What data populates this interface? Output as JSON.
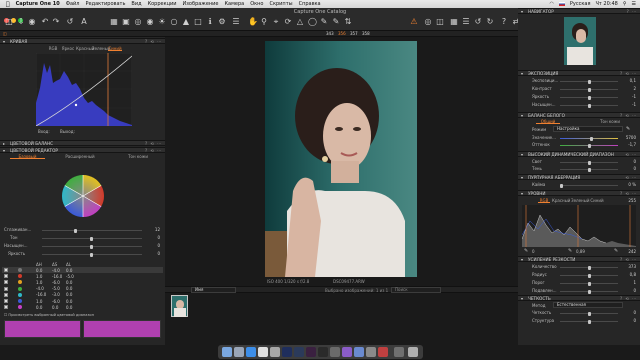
{
  "menubar": {
    "app_name": "Capture One 10",
    "items": [
      "Файл",
      "Редактировать",
      "Вид",
      "Коррекции",
      "Изображение",
      "Камера",
      "Окно",
      "Скрипты",
      "Справка"
    ],
    "input_source": "Русская",
    "clock": "Чт 20:48"
  },
  "window": {
    "title": "Capture One Catalog"
  },
  "exposure_readout": {
    "a": "343",
    "b": "356",
    "c": "357",
    "d": "358"
  },
  "left": {
    "curves": {
      "title": "КРИВАЯ",
      "tabs": [
        "RGB",
        "Яркос",
        "Красный",
        "Зеленый",
        "Синий"
      ],
      "active_tab": 4,
      "input_label": "Вход:",
      "output_label": "Выход:"
    },
    "color_balance": {
      "title": "ЦВЕТОВОЙ БАЛАНС"
    },
    "color_editor": {
      "title": "ЦВЕТОВОЙ РЕДАКТОР",
      "tabs": [
        "Базовый",
        "Расширенный",
        "Тон кожи"
      ],
      "active_tab": 0,
      "sliders": [
        {
          "label": "Сглаживан...",
          "value": "12"
        },
        {
          "label": "Тон",
          "value": "0"
        },
        {
          "label": "Насыщен...",
          "value": "0"
        },
        {
          "label": "Яркость",
          "value": "0"
        }
      ],
      "table_headers": [
        "ΔH",
        "ΔS",
        "ΔL"
      ],
      "rows": [
        {
          "color": "#777777",
          "h": "0.0",
          "s": "-4.0",
          "l": "0.0"
        },
        {
          "color": "#d23a2a",
          "h": "1.0",
          "s": "-16.0",
          "l": "-5.0"
        },
        {
          "color": "#e2a020",
          "h": "1.0",
          "s": "-6.0",
          "l": "0.0"
        },
        {
          "color": "#3fae3f",
          "h": "-4.0",
          "s": "-5.0",
          "l": "0.0"
        },
        {
          "color": "#2fb8c8",
          "h": "-16.0",
          "s": "-3.0",
          "l": "0.0"
        },
        {
          "color": "#3a5ad8",
          "h": "1.0",
          "s": "-6.0",
          "l": "0.0"
        },
        {
          "color": "#c840c8",
          "h": "0.0",
          "s": "0.0",
          "l": "0.0"
        }
      ],
      "view_selected": "Просмотреть выбранный цветовой диапазон",
      "swatch_color": "#b040b0"
    }
  },
  "viewer": {
    "caption": "ISO 400   1/320 s   f/2.8",
    "filename": "DSC09477.ARW",
    "filmstrip_label": "Имя",
    "filmstrip_count": "Выбрано изображений: 1 из 1",
    "search_placeholder": "Поиск"
  },
  "right": {
    "navigator": {
      "title": "НАВИГАТОР"
    },
    "exposure": {
      "title": "ЭКСПОЗИЦИЯ",
      "sliders": [
        {
          "label": "Экспозици...",
          "value": "0,1"
        },
        {
          "label": "Контраст",
          "value": "2"
        },
        {
          "label": "Яркость",
          "value": "-1"
        },
        {
          "label": "Насыщен...",
          "value": "-1"
        }
      ]
    },
    "white_balance": {
      "title": "БАЛАНС БЕЛОГО",
      "tabs": [
        "Общий",
        "Тон кожи"
      ],
      "active_tab": 0,
      "mode_label": "Режим",
      "mode_value": "Настройка",
      "kelvin_label": "Значение...",
      "kelvin_value": "5700",
      "tint_label": "Оттенок",
      "tint_value": "-1,7"
    },
    "hdr": {
      "title": "ВЫСОКИЙ ДИНАМИЧЕСКИЙ ДИАПАЗОН",
      "sliders": [
        {
          "label": "Свет",
          "value": "0"
        },
        {
          "label": "Тень",
          "value": "0"
        }
      ]
    },
    "purple": {
      "title": "ПУРПУРНАЯ АБЕРРАЦИЯ",
      "label": "Кайма",
      "value": "0 %"
    },
    "levels": {
      "title": "УРОВНИ",
      "tabs": [
        "RGB",
        "Красный",
        "Зеленый",
        "Синий"
      ],
      "active_tab": 0,
      "max": "255",
      "low_out": "0",
      "mid": "0,89",
      "high": "242"
    },
    "sharpening": {
      "title": "УСИЛЕНИЕ РЕЗКОСТИ",
      "sliders": [
        {
          "label": "Количество",
          "value": "373"
        },
        {
          "label": "Радиус",
          "value": "0,8"
        },
        {
          "label": "Порог",
          "value": "1"
        },
        {
          "label": "Подавлен...",
          "value": "0"
        }
      ]
    },
    "clarity": {
      "title": "ЧЕТКОСТЬ",
      "method_label": "Метод",
      "method_value": "Естественная",
      "sliders": [
        {
          "label": "Четкость",
          "value": "0"
        },
        {
          "label": "Структура",
          "value": "0"
        }
      ]
    }
  }
}
